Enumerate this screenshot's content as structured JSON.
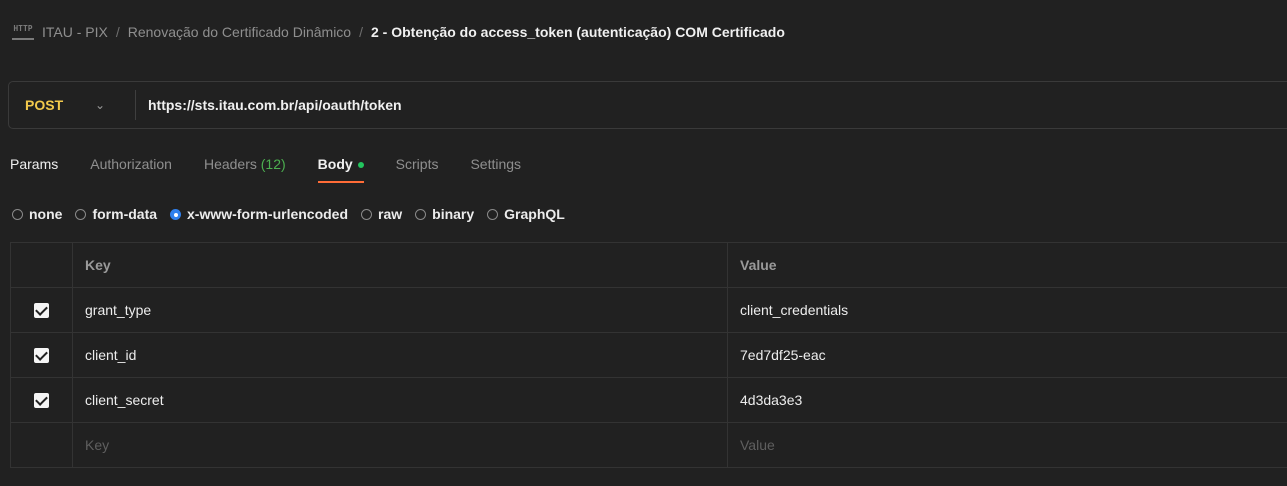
{
  "breadcrumb": {
    "icon": "http-icon",
    "items": [
      "ITAU - PIX",
      "Renovação do Certificado Dinâmico"
    ],
    "separator": "/",
    "current": "2 - Obtenção do access_token (autenticação) COM Certificado"
  },
  "request": {
    "method": "POST",
    "url": "https://sts.itau.com.br/api/oauth/token"
  },
  "tabs": [
    {
      "label": "Params",
      "state": "active-text"
    },
    {
      "label": "Authorization"
    },
    {
      "label": "Headers",
      "count": "(12)"
    },
    {
      "label": "Body",
      "selected": true
    },
    {
      "label": "Scripts"
    },
    {
      "label": "Settings"
    }
  ],
  "body_types": [
    {
      "label": "none",
      "selected": false
    },
    {
      "label": "form-data",
      "selected": false
    },
    {
      "label": "x-www-form-urlencoded",
      "selected": true
    },
    {
      "label": "raw",
      "selected": false
    },
    {
      "label": "binary",
      "selected": false
    },
    {
      "label": "GraphQL",
      "selected": false
    }
  ],
  "table": {
    "headers": {
      "key": "Key",
      "value": "Value"
    },
    "rows": [
      {
        "key": "grant_type",
        "value": "client_credentials",
        "checked": true
      },
      {
        "key": "client_id",
        "value": "7ed7df25-eac",
        "checked": true
      },
      {
        "key": "client_secret",
        "value": "4d3da3e3",
        "checked": true
      }
    ],
    "placeholders": {
      "key": "Key",
      "value": "Value"
    }
  },
  "colors": {
    "background": "#212121",
    "method": "#f2c94c",
    "accent_underline": "#ff6c37",
    "body_dot": "#22c55e",
    "radio_selected": "#2f80ed",
    "headers_count": "#4caf50"
  }
}
